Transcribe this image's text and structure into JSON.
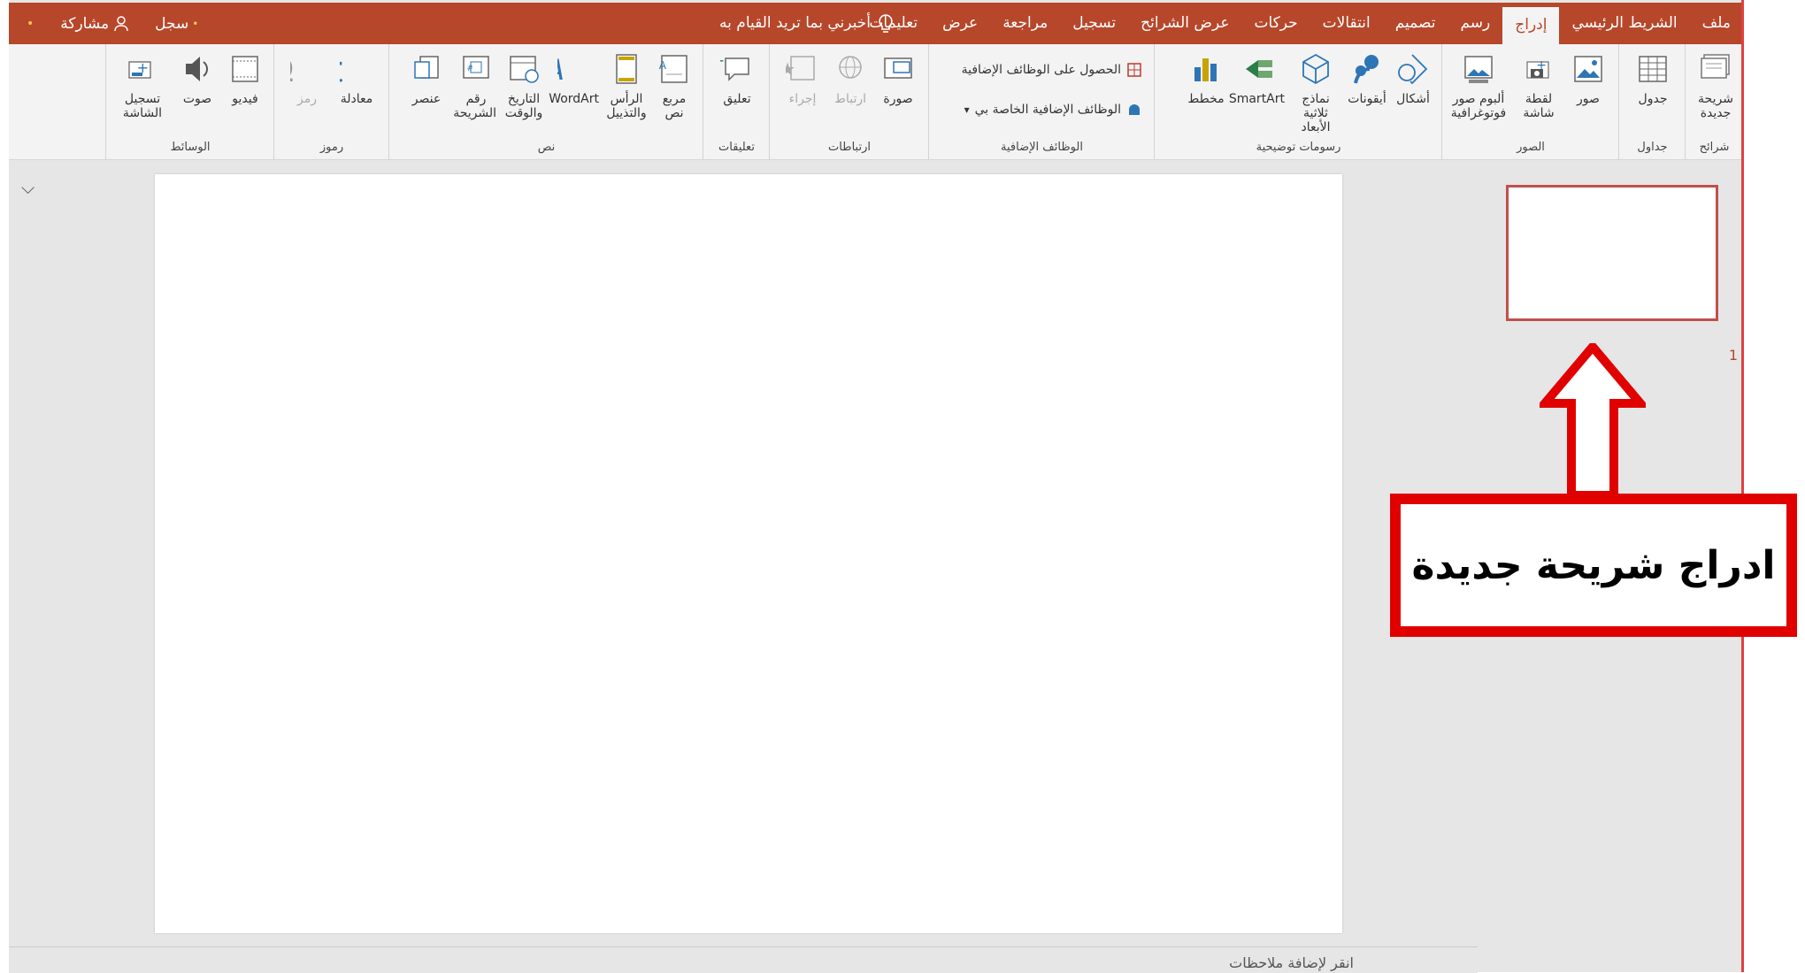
{
  "titlebar": {
    "tabs": [
      "ملف",
      "الشريط الرئيسي",
      "إدراج",
      "رسم",
      "تصميم",
      "انتقالات",
      "حركات",
      "عرض الشرائح",
      "تسجيل",
      "مراجعة",
      "عرض",
      "تعليمات"
    ],
    "active_tab": "إدراج",
    "tell_me": "أخبرني بما تريد القيام به",
    "record": "سجل",
    "share": "مشاركة"
  },
  "ribbon": {
    "groups": {
      "slides": "شرائح",
      "tables": "جداول",
      "images": "الصور",
      "illustrations": "رسومات توضيحية",
      "addins": "الوظائف الإضافية",
      "links": "ارتباطات",
      "comments": "تعليقات",
      "text": "نص",
      "symbols": "رموز",
      "media": "الوسائط"
    },
    "buttons": {
      "new_slide": "شريحة جديدة",
      "table": "جدول",
      "pictures": "صور",
      "screenshot": "لقطة شاشة",
      "photo_album": "ألبوم صور فوتوغرافية",
      "shapes": "أشكال",
      "icons": "أيقونات",
      "models_3d": "نماذج ثلاثية الأبعاد",
      "smartart": "SmartArt",
      "chart": "مخطط",
      "get_addins": "الحصول على الوظائف الإضافية",
      "my_addins": "الوظائف الإضافية الخاصة بي",
      "zoom": "صورة",
      "link": "ارتباط",
      "action": "إجراء",
      "comment": "تعليق",
      "text_box": "مربع نص",
      "header_footer": "الرأس والتذييل",
      "wordart": "WordArt",
      "date_time": "التاريخ والوقت",
      "slide_number": "رقم الشريحة",
      "object": "عنصر",
      "equation": "معادلة",
      "symbol": "رمز",
      "video": "فيديو",
      "audio": "صوت",
      "screen_recording": "تسجيل الشاشة"
    }
  },
  "thumbnails": {
    "slide_number": "1"
  },
  "notes": {
    "placeholder": "انقر لإضافة ملاحظات"
  },
  "callout": {
    "text": "ادراج شريحة جديدة"
  },
  "colors": {
    "accent": "#b7472a",
    "callout": "#e00000"
  }
}
